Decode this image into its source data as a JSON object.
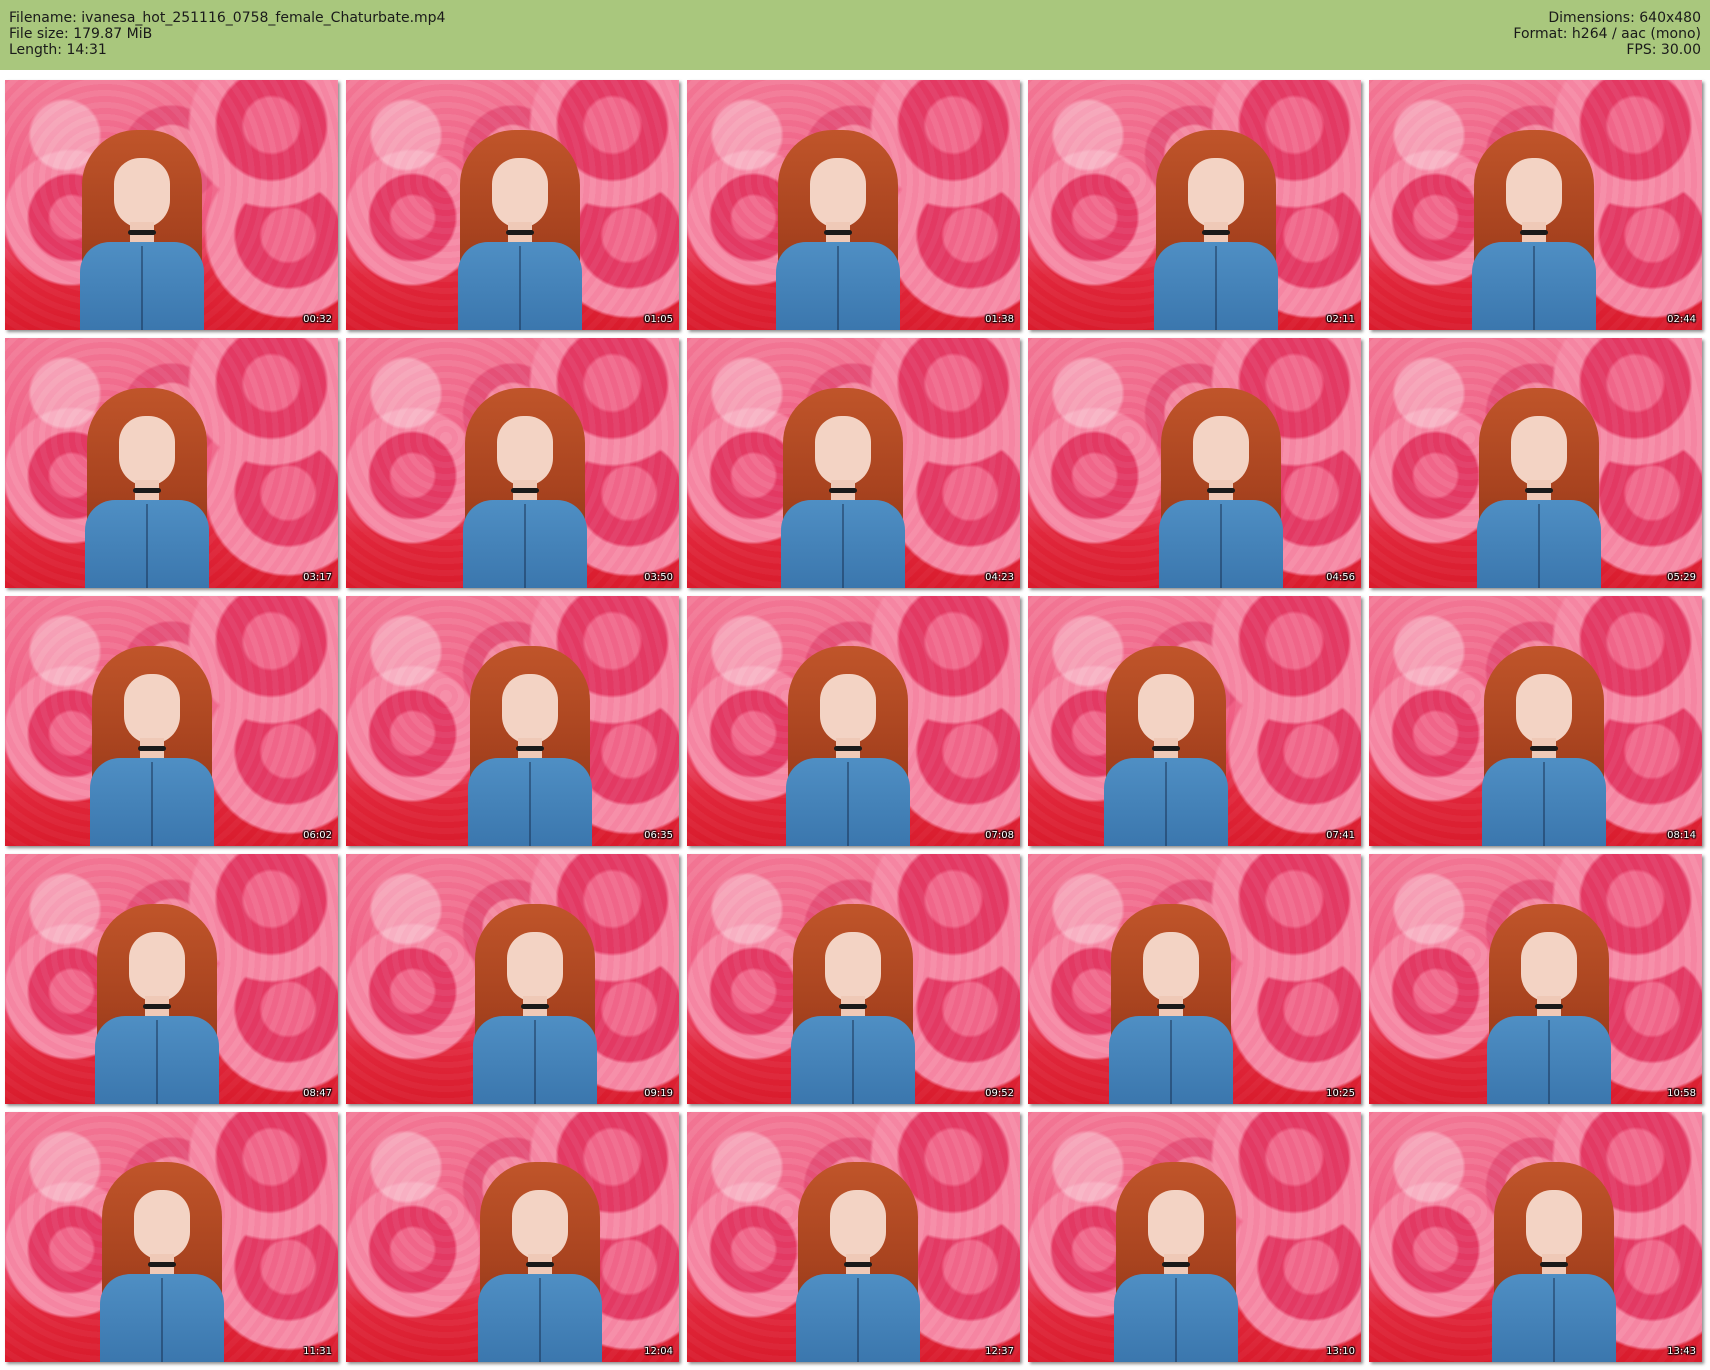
{
  "header": {
    "filename_line": "Filename: ivanesa_hot_251116_0758_female_Chaturbate.mp4",
    "filesize_line": "File size: 179.87 MiB",
    "length_line": "Length: 14:31",
    "dimensions_line": "Dimensions: 640x480",
    "format_line": "Format: h264 / aac (mono)",
    "fps_line": "FPS: 30.00",
    "background_color": "#a9c77d"
  },
  "thumbnails": [
    {
      "timestamp": "00:32"
    },
    {
      "timestamp": "01:05"
    },
    {
      "timestamp": "01:38"
    },
    {
      "timestamp": "02:11"
    },
    {
      "timestamp": "02:44"
    },
    {
      "timestamp": "03:17"
    },
    {
      "timestamp": "03:50"
    },
    {
      "timestamp": "04:23"
    },
    {
      "timestamp": "04:56"
    },
    {
      "timestamp": "05:29"
    },
    {
      "timestamp": "06:02"
    },
    {
      "timestamp": "06:35"
    },
    {
      "timestamp": "07:08"
    },
    {
      "timestamp": "07:41"
    },
    {
      "timestamp": "08:14"
    },
    {
      "timestamp": "08:47"
    },
    {
      "timestamp": "09:19"
    },
    {
      "timestamp": "09:52"
    },
    {
      "timestamp": "10:25"
    },
    {
      "timestamp": "10:58"
    },
    {
      "timestamp": "11:31"
    },
    {
      "timestamp": "12:04"
    },
    {
      "timestamp": "12:37"
    },
    {
      "timestamp": "13:10"
    },
    {
      "timestamp": "13:43"
    }
  ]
}
